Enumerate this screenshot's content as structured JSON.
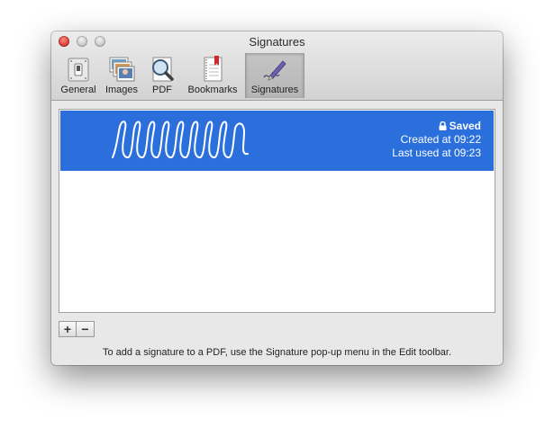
{
  "window": {
    "title": "Signatures"
  },
  "toolbar": {
    "tabs": [
      {
        "label": "General",
        "icon": "switch-icon"
      },
      {
        "label": "Images",
        "icon": "photos-icon"
      },
      {
        "label": "PDF",
        "icon": "magnifier-icon"
      },
      {
        "label": "Bookmarks",
        "icon": "bookmark-icon"
      },
      {
        "label": "Signatures",
        "icon": "pen-icon",
        "selected": true
      }
    ]
  },
  "signatures": [
    {
      "status": "Saved",
      "created": "Created at 09:22",
      "last_used": "Last used at 09:23",
      "selected": true
    }
  ],
  "buttons": {
    "add": "+",
    "remove": "−"
  },
  "hint": "To add a signature to a PDF, use the Signature pop-up menu in the Edit toolbar.",
  "colors": {
    "selection": "#2b6fdc",
    "window_bg": "#e8e8e8"
  }
}
